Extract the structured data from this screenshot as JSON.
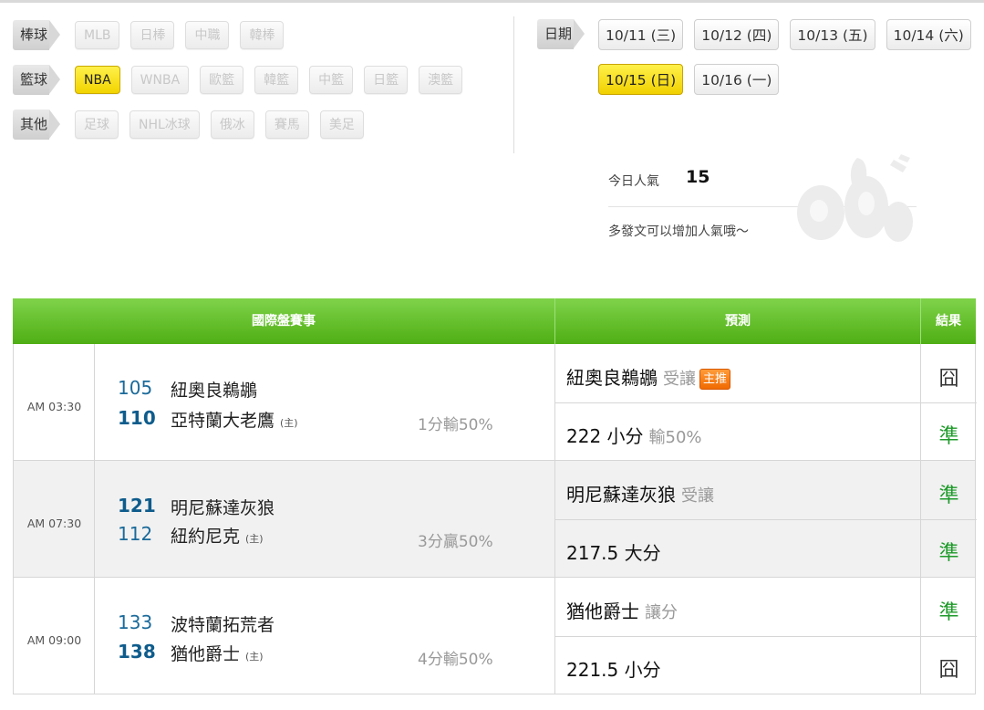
{
  "categories": [
    {
      "tag": "棒球",
      "items": [
        {
          "label": "MLB",
          "active": false
        },
        {
          "label": "日棒",
          "active": false
        },
        {
          "label": "中職",
          "active": false
        },
        {
          "label": "韓棒",
          "active": false
        }
      ]
    },
    {
      "tag": "籃球",
      "items": [
        {
          "label": "NBA",
          "active": true
        },
        {
          "label": "WNBA",
          "active": false
        },
        {
          "label": "歐籃",
          "active": false
        },
        {
          "label": "韓籃",
          "active": false
        },
        {
          "label": "中籃",
          "active": false
        },
        {
          "label": "日籃",
          "active": false
        },
        {
          "label": "澳籃",
          "active": false
        }
      ]
    },
    {
      "tag": "其他",
      "items": [
        {
          "label": "足球",
          "active": false
        },
        {
          "label": "NHL冰球",
          "active": false
        },
        {
          "label": "俄冰",
          "active": false
        },
        {
          "label": "賽馬",
          "active": false
        },
        {
          "label": "美足",
          "active": false
        }
      ]
    }
  ],
  "dates": {
    "tag": "日期",
    "items": [
      {
        "label": "10/11 (三)",
        "active": false
      },
      {
        "label": "10/12 (四)",
        "active": false
      },
      {
        "label": "10/13 (五)",
        "active": false
      },
      {
        "label": "10/14 (六)",
        "active": false
      },
      {
        "label": "10/15 (日)",
        "active": true
      },
      {
        "label": "10/16 (一)",
        "active": false
      }
    ]
  },
  "popularity": {
    "label": "今日人氣",
    "value": "15",
    "tip": "多發文可以增加人氣哦～"
  },
  "table": {
    "headers": {
      "match": "國際盤賽事",
      "prediction": "預測",
      "result": "結果"
    },
    "rows": [
      {
        "time": "AM 03:30",
        "away_score": "105",
        "away_team": "紐奧良鵜鶘",
        "home_score": "110",
        "home_team": "亞特蘭大老鷹",
        "home_mark": "(主)",
        "handicap": "1分輸50%",
        "pred1_team": "紐奧良鵜鶘",
        "pred1_type": "受讓",
        "pred1_badge": "主推",
        "pred1_result": "囧",
        "pred2_main": "222 小分",
        "pred2_sub": "輸50%",
        "pred2_result": "準"
      },
      {
        "time": "AM 07:30",
        "away_score": "121",
        "away_team": "明尼蘇達灰狼",
        "home_score": "112",
        "home_team": "紐約尼克",
        "home_mark": "(主)",
        "handicap": "3分贏50%",
        "pred1_team": "明尼蘇達灰狼",
        "pred1_type": "受讓",
        "pred1_badge": "",
        "pred1_result": "準",
        "pred2_main": "217.5 大分",
        "pred2_sub": "",
        "pred2_result": "準"
      },
      {
        "time": "AM 09:00",
        "away_score": "133",
        "away_team": "波特蘭拓荒者",
        "home_score": "138",
        "home_team": "猶他爵士",
        "home_mark": "(主)",
        "handicap": "4分輸50%",
        "pred1_team": "猶他爵士",
        "pred1_type": "讓分",
        "pred1_badge": "",
        "pred1_result": "準",
        "pred2_main": "221.5 小分",
        "pred2_sub": "",
        "pred2_result": "囧"
      }
    ]
  }
}
